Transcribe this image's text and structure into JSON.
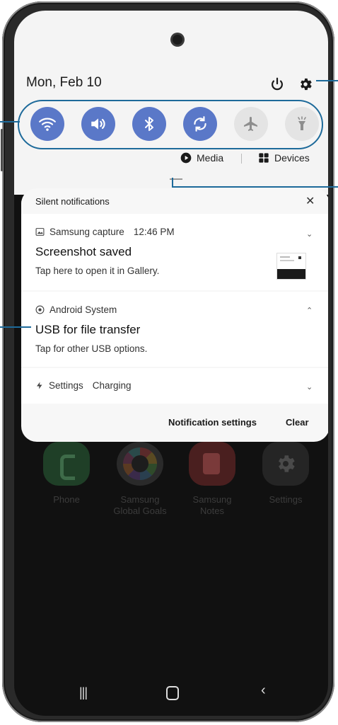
{
  "status": {
    "date": "Mon, Feb 10"
  },
  "quick_settings": {
    "tiles": [
      {
        "name": "wifi",
        "icon": "wifi-icon",
        "active": true
      },
      {
        "name": "sound",
        "icon": "volume-icon",
        "active": true
      },
      {
        "name": "bluetooth",
        "icon": "bluetooth-icon",
        "active": true
      },
      {
        "name": "auto-rotate",
        "icon": "rotate-icon",
        "active": true
      },
      {
        "name": "airplane",
        "icon": "airplane-icon",
        "active": false
      },
      {
        "name": "flashlight",
        "icon": "flashlight-icon",
        "active": false
      }
    ],
    "media_label": "Media",
    "devices_label": "Devices"
  },
  "notifications": {
    "header": "Silent notifications",
    "items": [
      {
        "app": "Samsung capture",
        "time": "12:46 PM",
        "title": "Screenshot saved",
        "text": "Tap here to open it in Gallery."
      },
      {
        "app": "Android System",
        "title": "USB for file transfer",
        "text": "Tap for other USB options."
      },
      {
        "app": "Settings",
        "status": "Charging"
      }
    ],
    "settings_label": "Notification settings",
    "clear_label": "Clear"
  },
  "home_apps": [
    {
      "label": "Phone"
    },
    {
      "label": "Samsung Global Goals"
    },
    {
      "label": "Samsung Notes"
    },
    {
      "label": "Settings"
    }
  ],
  "colors": {
    "tile_active": "#5a78c8",
    "tile_inactive": "#e4e4e4",
    "callout": "#1d6a9a"
  }
}
